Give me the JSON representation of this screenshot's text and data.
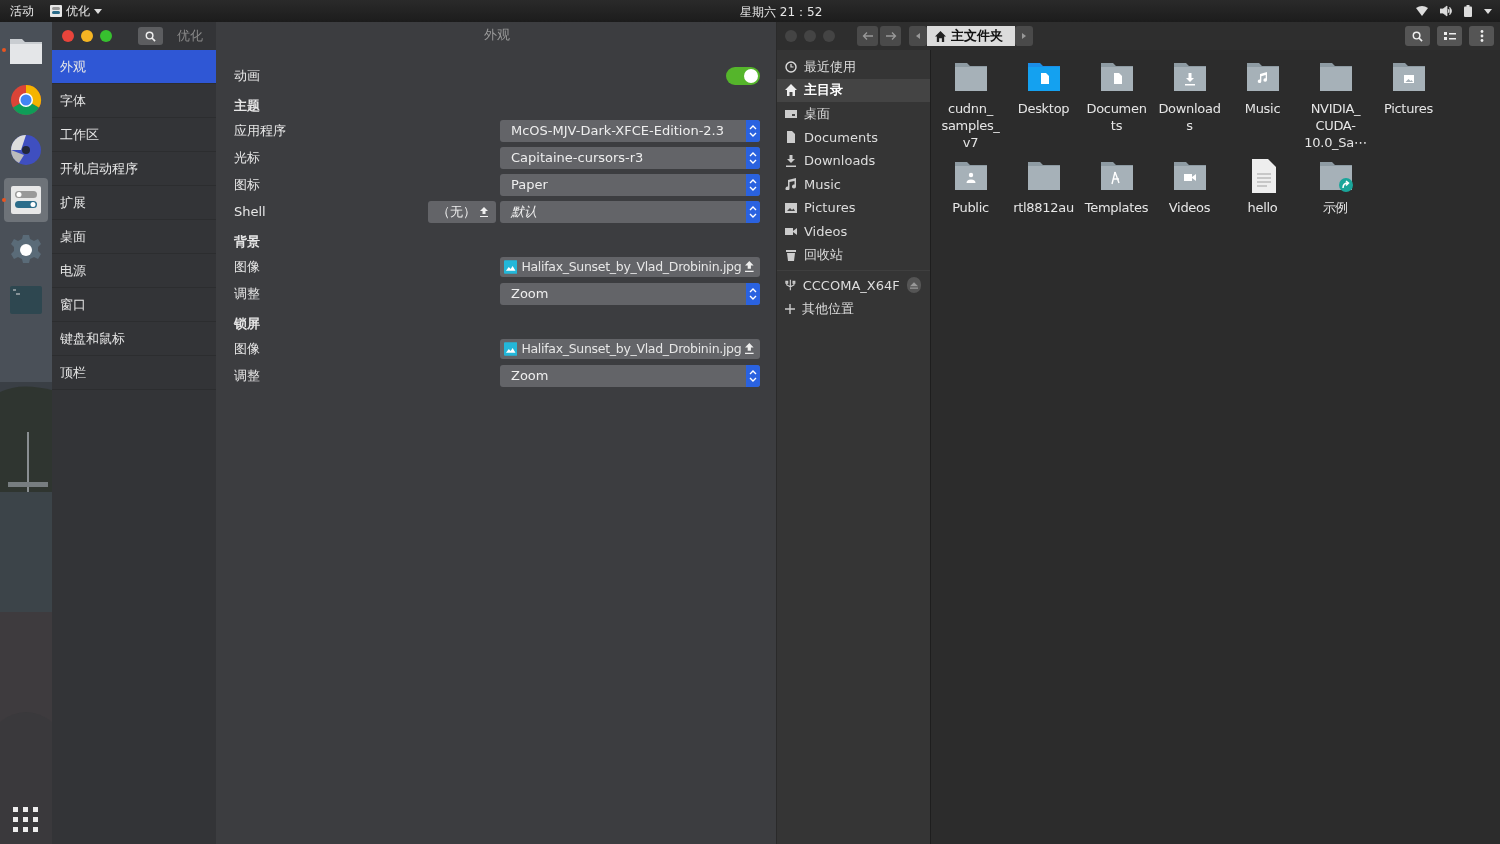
{
  "top_bar": {
    "activities": "活动",
    "app_menu": "优化",
    "clock": "星期六 21：52"
  },
  "dock": {
    "items": [
      {
        "kind": "files",
        "running": true,
        "selected": false
      },
      {
        "kind": "browser",
        "running": false,
        "selected": false
      },
      {
        "kind": "aperture",
        "running": false,
        "selected": false
      },
      {
        "kind": "tweaks",
        "running": true,
        "selected": true
      },
      {
        "kind": "settings",
        "running": false,
        "selected": false
      },
      {
        "kind": "terminal",
        "running": false,
        "selected": false
      }
    ]
  },
  "tweaks": {
    "title": "优化",
    "page_title": "外观",
    "sidebar": [
      {
        "label": "外观",
        "selected": true
      },
      {
        "label": "字体",
        "selected": false
      },
      {
        "label": "工作区",
        "selected": false
      },
      {
        "label": "开机启动程序",
        "selected": false
      },
      {
        "label": "扩展",
        "selected": false
      },
      {
        "label": "桌面",
        "selected": false
      },
      {
        "label": "电源",
        "selected": false
      },
      {
        "label": "窗口",
        "selected": false
      },
      {
        "label": "键盘和鼠标",
        "selected": false
      },
      {
        "label": "顶栏",
        "selected": false
      }
    ],
    "rows": [
      {
        "kind": "switch",
        "label": "动画",
        "on": true
      },
      {
        "kind": "heading",
        "label": "主题"
      },
      {
        "kind": "combo",
        "label": "应用程序",
        "value": "McOS-MJV-Dark-XFCE-Edition-2.3"
      },
      {
        "kind": "combo",
        "label": "光标",
        "value": "Capitaine-cursors-r3"
      },
      {
        "kind": "combo",
        "label": "图标",
        "value": "Paper"
      },
      {
        "kind": "shell",
        "label": "Shell",
        "button": "（无）",
        "value": "默认"
      },
      {
        "kind": "heading",
        "label": "背景"
      },
      {
        "kind": "file",
        "label": "图像",
        "value": "Halifax_Sunset_by_Vlad_Drobinin.jpg"
      },
      {
        "kind": "combo",
        "label": "调整",
        "value": "Zoom"
      },
      {
        "kind": "heading",
        "label": "锁屏"
      },
      {
        "kind": "file",
        "label": "图像",
        "value": "Halifax_Sunset_by_Vlad_Drobinin.jpg"
      },
      {
        "kind": "combo",
        "label": "调整",
        "value": "Zoom"
      }
    ]
  },
  "files": {
    "path": "主文件夹",
    "sidebar": [
      {
        "kind": "recent",
        "label": "最近使用",
        "selected": false
      },
      {
        "kind": "home",
        "label": "主目录",
        "selected": true
      },
      {
        "kind": "desktop",
        "label": "桌面",
        "selected": false
      },
      {
        "kind": "document",
        "label": "Documents",
        "selected": false
      },
      {
        "kind": "download",
        "label": "Downloads",
        "selected": false
      },
      {
        "kind": "music",
        "label": "Music",
        "selected": false
      },
      {
        "kind": "picture",
        "label": "Pictures",
        "selected": false
      },
      {
        "kind": "video",
        "label": "Videos",
        "selected": false
      },
      {
        "kind": "trash",
        "label": "回收站",
        "selected": false
      }
    ],
    "device": "CCCOMA_X64F",
    "other": "其他位置",
    "items": [
      {
        "kind": "folder",
        "name": "cudnn_\nsamples_\nv7"
      },
      {
        "kind": "desktop",
        "name": "Desktop"
      },
      {
        "kind": "document",
        "name": "Documen\nts"
      },
      {
        "kind": "download",
        "name": "Download\ns"
      },
      {
        "kind": "music",
        "name": "Music"
      },
      {
        "kind": "folder",
        "name": "NVIDIA_\nCUDA-\n10.0_Sa⋯"
      },
      {
        "kind": "picture",
        "name": "Pictures"
      },
      {
        "kind": "public",
        "name": "Public"
      },
      {
        "kind": "folder",
        "name": "rtl8812au"
      },
      {
        "kind": "template",
        "name": "Templates"
      },
      {
        "kind": "video",
        "name": "Videos"
      },
      {
        "kind": "text",
        "name": "hello"
      },
      {
        "kind": "link",
        "name": "示例"
      }
    ]
  }
}
